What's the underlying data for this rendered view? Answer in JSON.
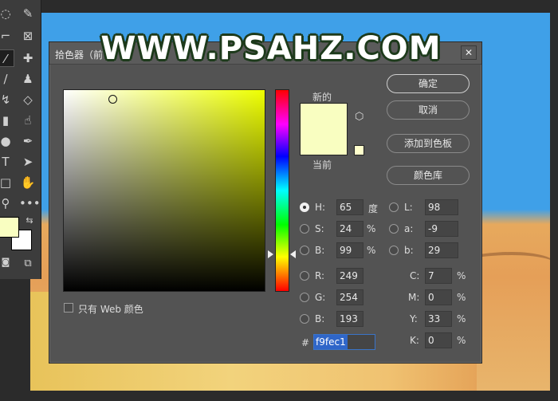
{
  "watermark": "WWW.PSAHZ.COM",
  "toolbar": {
    "foreground_color": "#f9fec1",
    "background_color": "#ffffff"
  },
  "dialog": {
    "title": "拾色器（前",
    "new_label": "新的",
    "current_label": "当前",
    "new_color": "#f9fec1",
    "buttons": {
      "ok": "确定",
      "cancel": "取消",
      "add_swatch": "添加到色板",
      "color_libraries": "颜色库"
    },
    "hsb": {
      "h_label": "H:",
      "h_value": "65",
      "h_unit": "度",
      "s_label": "S:",
      "s_value": "24",
      "s_unit": "%",
      "b_label": "B:",
      "b_value": "99",
      "b_unit": "%"
    },
    "rgb": {
      "r_label": "R:",
      "r_value": "249",
      "g_label": "G:",
      "g_value": "254",
      "b_label": "B:",
      "b_value": "193"
    },
    "lab": {
      "l_label": "L:",
      "l_value": "98",
      "a_label": "a:",
      "a_value": "-9",
      "b_label": "b:",
      "b_value": "29"
    },
    "cmyk": {
      "c_label": "C:",
      "c_value": "7",
      "c_unit": "%",
      "m_label": "M:",
      "m_value": "0",
      "m_unit": "%",
      "y_label": "Y:",
      "y_value": "33",
      "y_unit": "%",
      "k_label": "K:",
      "k_value": "0",
      "k_unit": "%"
    },
    "hex_label": "#",
    "hex_value": "f9fec1",
    "web_only_label": "只有 Web 颜色"
  }
}
